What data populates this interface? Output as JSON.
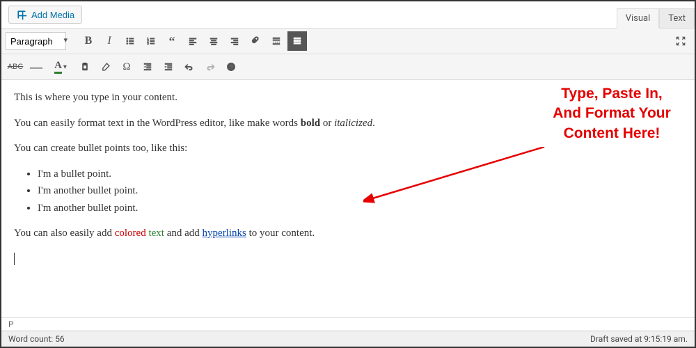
{
  "buttons": {
    "add_media": "Add Media"
  },
  "tabs": {
    "visual": "Visual",
    "text": "Text",
    "active": "visual"
  },
  "toolbar": {
    "format_selected": "Paragraph"
  },
  "content": {
    "p1": "This is where you type in your content.",
    "p2_a": "You can easily format text in the WordPress editor, like make words ",
    "p2_bold": "bold",
    "p2_b": " or ",
    "p2_ital": "italicized",
    "p2_c": ".",
    "p3": "You can create bullet points too, like this:",
    "bullets": {
      "b1": "I'm a bullet point.",
      "b2": "I'm another bullet point.",
      "b3": "I'm another bullet point."
    },
    "p4_a": "You can also easily add ",
    "p4_colored": "colored",
    "p4_b": " ",
    "p4_text": "text",
    "p4_c": " and add ",
    "p4_link": "hyperlinks",
    "p4_d": " to your content."
  },
  "annotation": {
    "line1": "Type, Paste In,",
    "line2": "And Format Your",
    "line3": "Content Here!"
  },
  "pathbar": "P",
  "status": {
    "wordcount_label": "Word count: ",
    "wordcount_value": "56",
    "draft_saved": "Draft saved at 9:15:19 am."
  }
}
